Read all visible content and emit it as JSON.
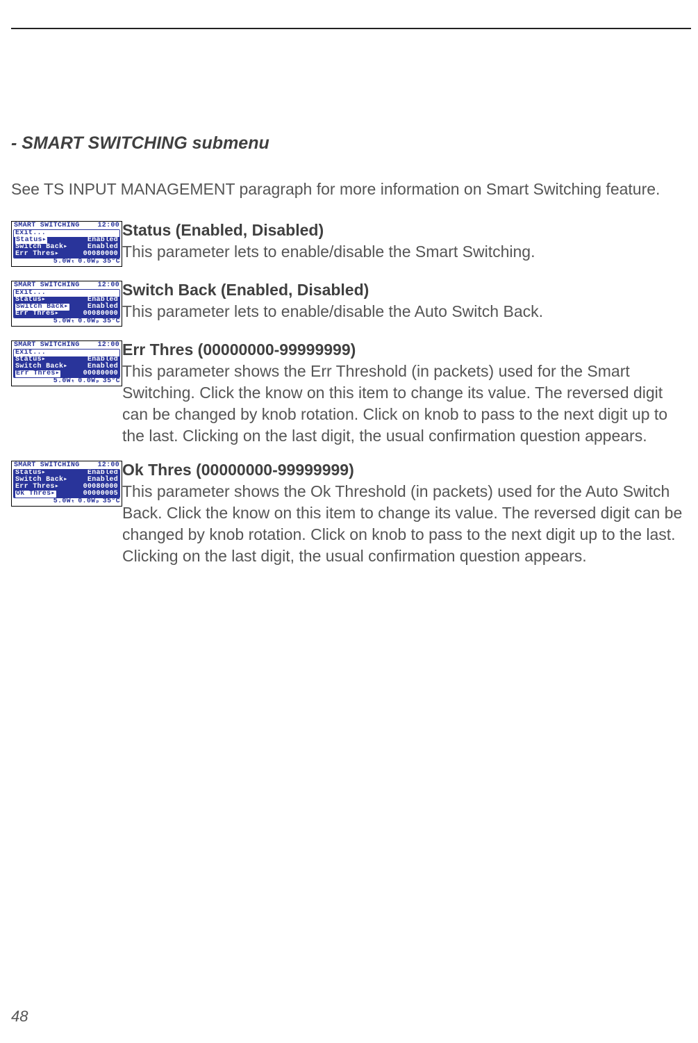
{
  "section_title": "- SMART SWITCHING submenu",
  "intro_text": "See TS INPUT MANAGEMENT paragraph for more information on Smart Switching feature.",
  "page_number": "48",
  "lcd_common": {
    "header_title": "SMART SWITCHING",
    "header_time": "12:00",
    "footer_a": "5.0Wₜ",
    "footer_b": "0.0Wₚ",
    "footer_c": "35°C"
  },
  "items": [
    {
      "heading": "Status (Enabled, Disabled)",
      "body": "This parameter lets to enable/disable the Smart Switching.",
      "lcd_rows": [
        {
          "label": "Exit...",
          "value": "",
          "style": "exit"
        },
        {
          "label": "Status▸",
          "value": "Enabled",
          "style": "sel"
        },
        {
          "label": "Switch Back▸",
          "value": "Enabled",
          "style": ""
        },
        {
          "label": "Err Thres▸",
          "value": "00080000",
          "style": ""
        }
      ]
    },
    {
      "heading": "Switch Back (Enabled, Disabled)",
      "body": "This parameter lets to enable/disable the Auto Switch Back.",
      "lcd_rows": [
        {
          "label": "Exit...",
          "value": "",
          "style": "exit"
        },
        {
          "label": "Status▸",
          "value": "Enabled",
          "style": ""
        },
        {
          "label": "Switch Back▸",
          "value": "Enabled",
          "style": "sel"
        },
        {
          "label": "Err Thres▸",
          "value": "00080000",
          "style": ""
        }
      ]
    },
    {
      "heading": "Err Thres (00000000-99999999)",
      "body": "This parameter shows the Err Threshold (in packets) used for the Smart Switching. Click the know on this item to change its value. The reversed digit can be changed by knob rotation. Click on knob to pass to the next digit up to the last. Clicking on the last digit, the usual confirmation question appears.",
      "lcd_rows": [
        {
          "label": "Exit...",
          "value": "",
          "style": "exit"
        },
        {
          "label": "Status▸",
          "value": "Enabled",
          "style": ""
        },
        {
          "label": "Switch Back▸",
          "value": "Enabled",
          "style": ""
        },
        {
          "label": "Err Thres▸",
          "value": "00080000",
          "style": "sel"
        }
      ]
    },
    {
      "heading": "Ok Thres (00000000-99999999)",
      "body": "This parameter shows the Ok Threshold (in packets) used for the Auto Switch Back. Click the know on this item to change its value. The reversed digit can be changed by knob rotation. Click on knob to pass to the next digit up to the last. Clicking on the last digit, the usual confirmation question appears.",
      "lcd_rows": [
        {
          "label": "Status▸",
          "value": "Enabled",
          "style": ""
        },
        {
          "label": "Switch Back▸",
          "value": "Enabled",
          "style": ""
        },
        {
          "label": "Err Thres▸",
          "value": "00080000",
          "style": ""
        },
        {
          "label": "Ok Thres▸",
          "value": "00000005",
          "style": "sel"
        }
      ]
    }
  ]
}
